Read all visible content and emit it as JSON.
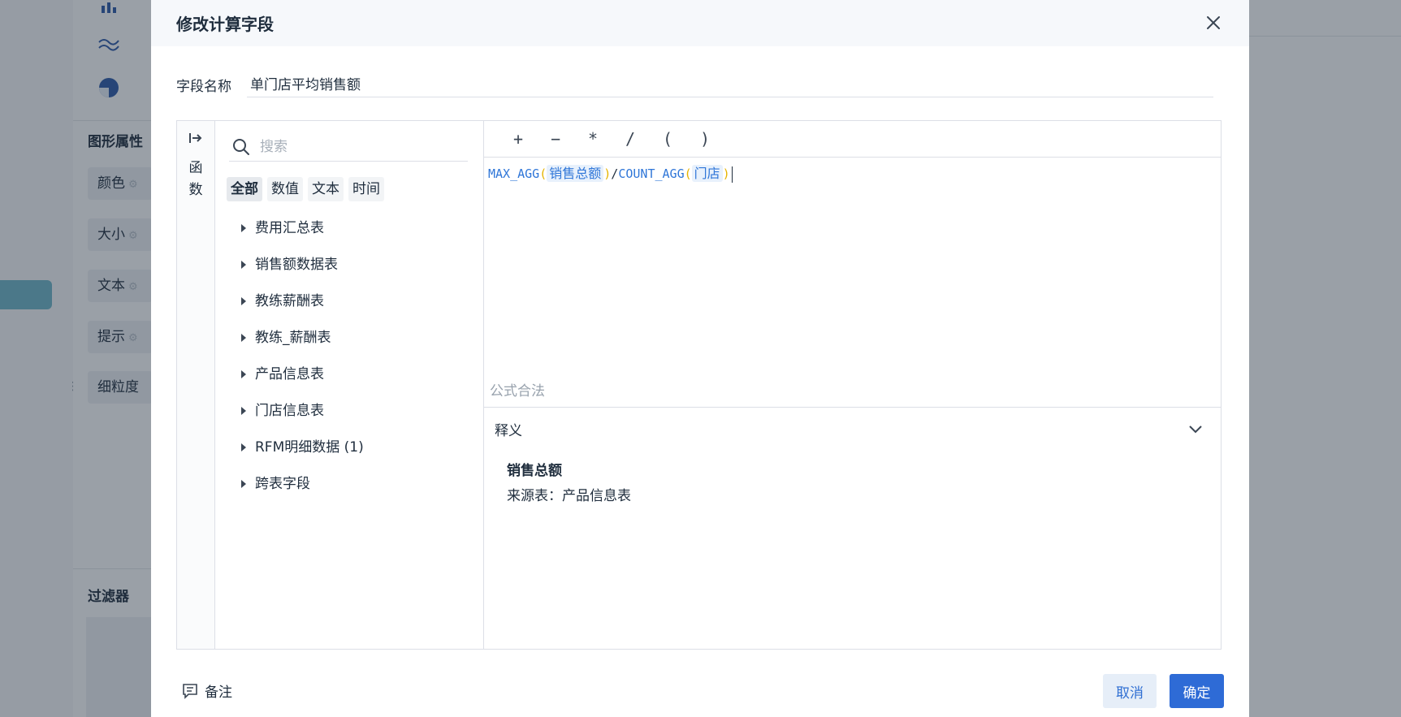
{
  "background": {
    "section_graph_props": "图形属性",
    "props": [
      "颜色",
      "大小",
      "文本",
      "提示",
      "细粒度"
    ],
    "section_filter": "过滤器",
    "chart_icons": [
      "bar-chart-icon",
      "line-chart-icon",
      "pie-chart-icon"
    ]
  },
  "dialog": {
    "title": "修改计算字段",
    "close_icon": "close-icon"
  },
  "field_name": {
    "label": "字段名称",
    "value": "单门店平均销售额"
  },
  "function_rail": {
    "label": "函数"
  },
  "field_panel": {
    "search_placeholder": "搜索",
    "tabs": [
      {
        "label": "全部",
        "active": true
      },
      {
        "label": "数值",
        "active": false
      },
      {
        "label": "文本",
        "active": false
      },
      {
        "label": "时间",
        "active": false
      }
    ],
    "tables": [
      "费用汇总表",
      "销售额数据表",
      "教练薪酬表",
      "教练_薪酬表",
      "产品信息表",
      "门店信息表",
      "RFM明细数据 (1)",
      "跨表字段"
    ]
  },
  "formula": {
    "operators": [
      "+",
      "−",
      "*",
      "/",
      "(",
      ")"
    ],
    "fn1": "MAX_AGG",
    "field1": "销售总额",
    "op": "/",
    "fn2": "COUNT_AGG",
    "field2": "门店",
    "open_paren": "(",
    "close_paren": ")",
    "status": "公式合法"
  },
  "explanation": {
    "header": "释义",
    "field": "销售总额",
    "source": "来源表：产品信息表"
  },
  "footer": {
    "note_label": "备注",
    "cancel_label": "取消",
    "ok_label": "确定"
  },
  "colors": {
    "primary": "#2e6bd6",
    "function_token": "#2f76d8",
    "paren_token": "#e6b400",
    "status_text": "#98a2ad"
  }
}
